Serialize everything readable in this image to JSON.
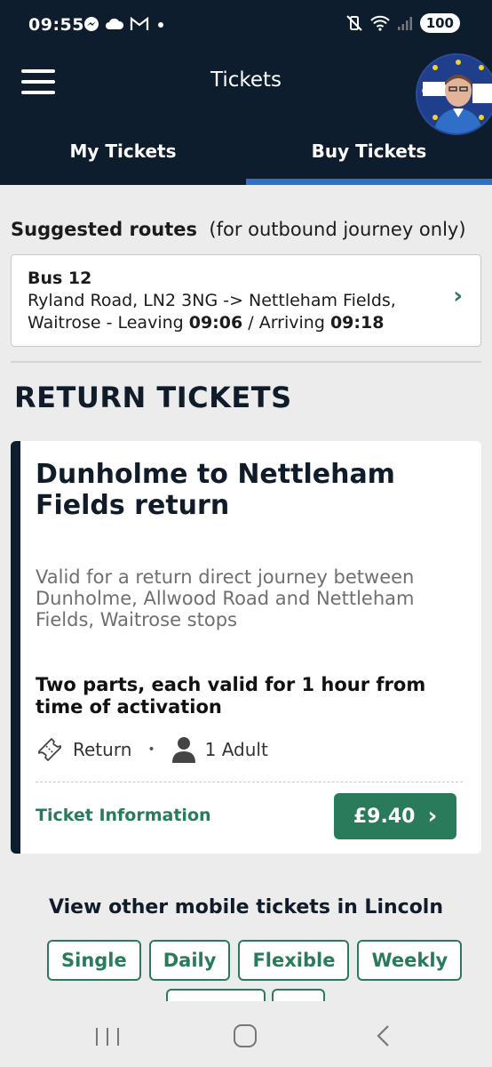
{
  "status_bar": {
    "time": "09:55",
    "battery": "100",
    "left_icons": [
      "messenger-icon",
      "cloud-icon",
      "gmail-icon",
      "dot-icon"
    ],
    "right_icons": [
      "vibrate-off-icon",
      "wifi-icon",
      "signal-icon"
    ]
  },
  "header": {
    "title": "Tickets",
    "tabs": [
      {
        "label": "My Tickets",
        "active": false
      },
      {
        "label": "Buy Tickets",
        "active": true
      }
    ]
  },
  "suggested": {
    "heading": "Suggested routes",
    "note": "(for outbound journey only)",
    "route": {
      "bus": "Bus 12",
      "line1": "Ryland Road, LN2 3NG -> Nettleham Fields,",
      "line2_prefix": "Waitrose - Leaving ",
      "leaving": "09:06",
      "separator": " / Arriving ",
      "arriving": "09:18"
    }
  },
  "section_title": "RETURN TICKETS",
  "ticket": {
    "name": "Dunholme to Nettleham Fields return",
    "description": "Valid for a return direct journey between Dunholme, Allwood Road and Nettleham Fields, Waitrose stops",
    "validity": "Two parts, each valid for 1 hour from time of activation",
    "type": "Return",
    "passengers": "1 Adult",
    "info_link": "Ticket Information",
    "price": "£9.40"
  },
  "other": {
    "heading": "View other mobile tickets in Lincoln",
    "chips": [
      "Single",
      "Daily",
      "Flexible",
      "Weekly"
    ]
  },
  "colors": {
    "navy": "#0e1d2e",
    "accent_blue": "#2f71c4",
    "green": "#2a7b5c",
    "background": "#ececec"
  }
}
